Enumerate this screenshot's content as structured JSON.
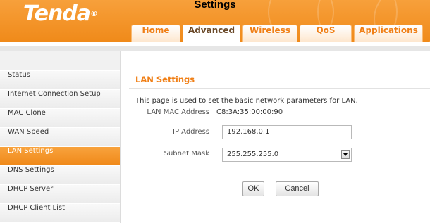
{
  "caption": "Settings",
  "brand": {
    "logo_text": "Tenda",
    "trademark": "®"
  },
  "tabs": [
    {
      "label": "Home",
      "active": false
    },
    {
      "label": "Advanced",
      "active": true
    },
    {
      "label": "Wireless",
      "active": false
    },
    {
      "label": "QoS",
      "active": false
    },
    {
      "label": "Applications",
      "active": false
    }
  ],
  "sidebar": {
    "items": [
      {
        "label": "Status",
        "active": false
      },
      {
        "label": "Internet Connection Setup",
        "active": false
      },
      {
        "label": "MAC Clone",
        "active": false
      },
      {
        "label": "WAN Speed",
        "active": false
      },
      {
        "label": "LAN Settings",
        "active": true
      },
      {
        "label": "DNS Settings",
        "active": false
      },
      {
        "label": "DHCP Server",
        "active": false
      },
      {
        "label": "DHCP Client List",
        "active": false
      }
    ]
  },
  "main": {
    "title": "LAN Settings",
    "description": "This page is used to set the basic network parameters for LAN.",
    "lan_mac": {
      "label": "LAN MAC Address",
      "value": "C8:3A:35:00:00:90"
    },
    "ip_address": {
      "label": "IP Address",
      "value": "192.168.0.1"
    },
    "subnet_mask": {
      "label": "Subnet Mask",
      "value": "255.255.255.0"
    },
    "ok_label": "OK",
    "cancel_label": "Cancel"
  },
  "colors": {
    "accent": "#f08a1a",
    "active_tab_text": "#6b4a2a"
  }
}
